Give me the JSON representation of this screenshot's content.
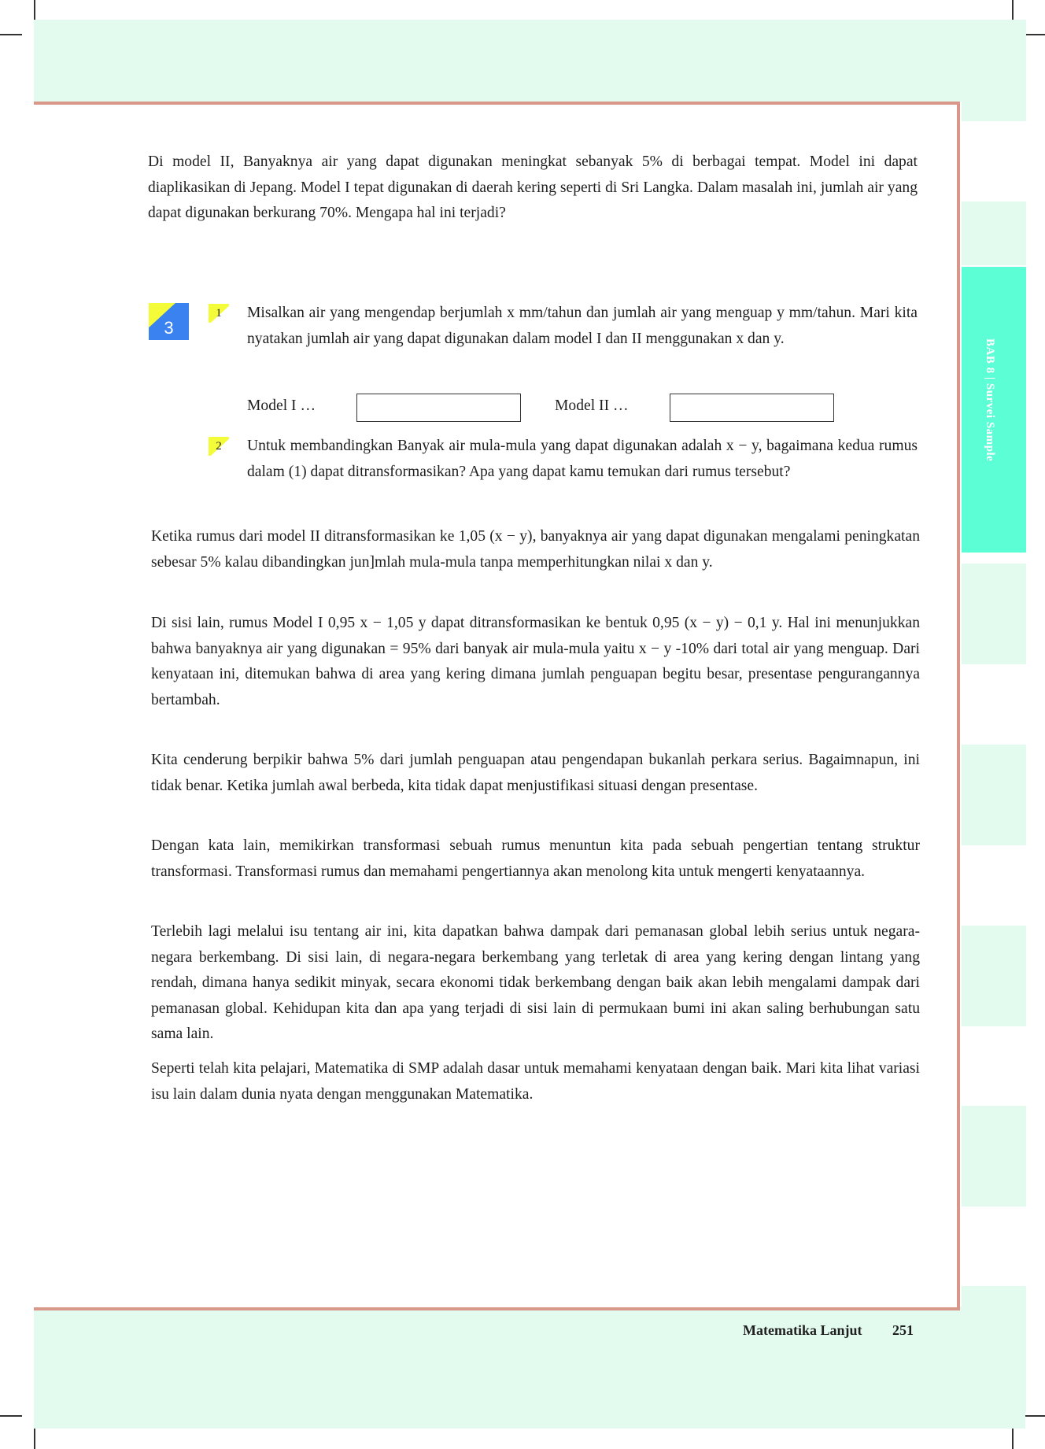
{
  "sidebar": {
    "label": "BAB 8 | Survei Sample",
    "accent_color": "#5cfed6",
    "band_color": "#e3fbef"
  },
  "body": {
    "intro": "Di model II, Banyaknya air yang dapat digunakan meningkat sebanyak 5% di berbagai tempat. Model ini dapat diaplikasikan di Jepang. Model I tepat digunakan di daerah kering seperti di Sri Langka. Dalam masalah ini, jumlah air yang dapat digunakan berkurang 70%. Mengapa hal ini terjadi?",
    "section_number": "3",
    "item1_number": "1",
    "item1_text": "Misalkan air yang mengendap berjumlah x mm/tahun dan jumlah air yang menguap y mm/tahun. Mari kita nyatakan jumlah air yang dapat digunakan dalam model I dan II menggunakan x dan y.",
    "model1_label": "Model I …",
    "model2_label": "Model II …",
    "item2_number": "2",
    "item2_text": "Untuk membandingkan Banyak air mula-mula yang dapat digunakan adalah x − y, bagaimana kedua rumus dalam (1) dapat ditransformasikan? Apa yang dapat kamu temukan dari rumus tersebut?",
    "para_model2": "Ketika rumus dari model II ditransformasikan ke 1,05 (x − y), banyaknya  air yang dapat digunakan mengalami peningkatan sebesar 5% kalau dibandingkan jun]mlah mula-mula tanpa memperhitungkan nilai x dan y.",
    "para_model1": "Di sisi lain, rumus Model I 0,95 x − 1,05 y dapat ditransformasikan ke bentuk 0,95 (x − y) − 0,1 y. Hal ini menunjukkan bahwa banyaknya air yang digunakan = 95% dari banyak air mula-mula yaitu x − y -10% dari total air yang menguap. Dari kenyataan ini, ditemukan bahwa di area yang kering dimana jumlah penguapan begitu besar, presentase pengurangannya bertambah.",
    "para_a": "Kita cenderung berpikir bahwa 5% dari jumlah penguapan atau pengendapan bukanlah perkara serius. Bagaimnapun, ini tidak benar. Ketika jumlah awal berbeda, kita tidak dapat menjustifikasi situasi dengan presentase.",
    "para_b": "Dengan kata lain, memikirkan transformasi sebuah rumus menuntun kita pada sebuah pengertian tentang struktur transformasi. Transformasi rumus dan memahami pengertiannya akan menolong kita untuk mengerti kenyataannya.",
    "para_c": "Terlebih lagi melalui isu tentang air ini, kita dapatkan bahwa dampak dari pemanasan global lebih serius untuk negara-negara berkembang. Di sisi lain, di negara-negara berkembang yang terletak di area yang kering dengan lintang yang rendah, dimana hanya sedikit minyak, secara ekonomi tidak berkembang dengan baik akan lebih mengalami dampak dari pemanasan global. Kehidupan kita dan  apa yang terjadi di sisi lain di permukaan bumi ini akan saling berhubungan satu sama lain.",
    "para_d": "Seperti telah kita pelajari, Matematika di SMP adalah dasar untuk memahami kenyataan dengan baik. Mari kita lihat variasi isu lain dalam dunia nyata dengan menggunakan Matematika."
  },
  "footer": {
    "title": "Matematika Lanjut",
    "page_number": "251"
  }
}
